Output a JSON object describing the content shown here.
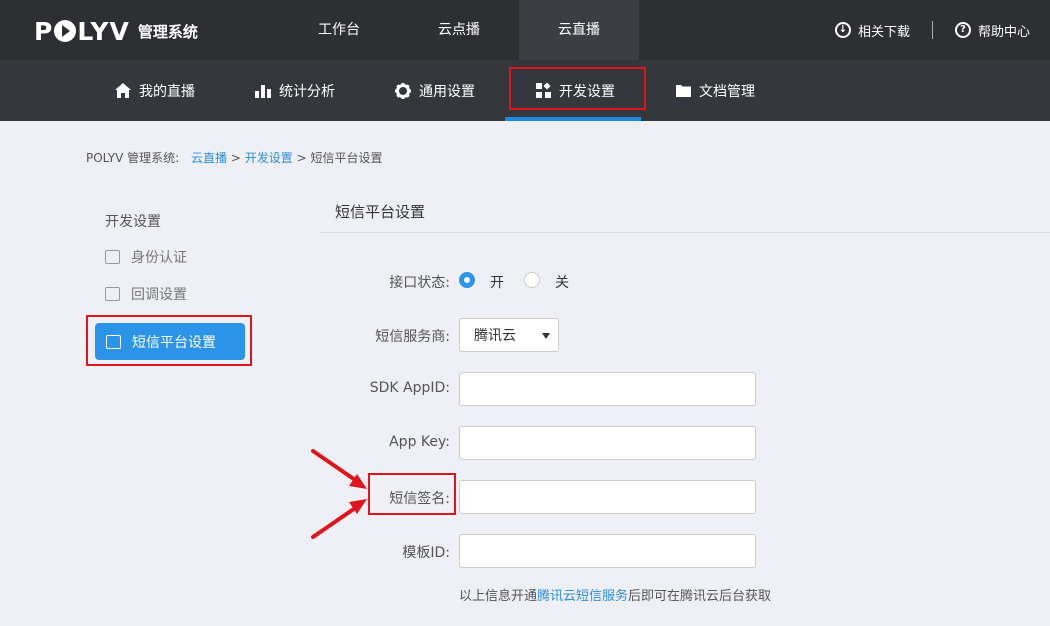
{
  "header": {
    "logo": "POLYV",
    "logo_sub": "管理系统",
    "nav": [
      "工作台",
      "云点播",
      "云直播"
    ],
    "active_nav": "云直播",
    "right": {
      "download": "相关下载",
      "help": "帮助中心"
    }
  },
  "subnav": {
    "items": [
      "我的直播",
      "统计分析",
      "通用设置",
      "开发设置",
      "文档管理"
    ],
    "active": "开发设置"
  },
  "breadcrumb": {
    "prefix": "POLYV 管理系统:",
    "link1": "云直播",
    "sep1": ">",
    "link2": "开发设置",
    "sep2": ">",
    "current": "短信平台设置"
  },
  "sidebar": {
    "title": "开发设置",
    "items": [
      "身份认证",
      "回调设置"
    ],
    "active": "短信平台设置"
  },
  "form": {
    "title": "短信平台设置",
    "status_label": "接口状态:",
    "status_on": "开",
    "status_off": "关",
    "status_value": "开",
    "provider_label": "短信服务商:",
    "provider_value": "腾讯云",
    "sdk_label": "SDK AppID:",
    "sdk_value": "",
    "appkey_label": "App Key:",
    "appkey_value": "",
    "sign_label": "短信签名:",
    "sign_value": "",
    "template_label": "模板ID:",
    "template_value": "",
    "note_before": "以上信息开通",
    "note_link": "腾讯云短信服务",
    "note_after": "后即可在腾讯云后台获取"
  },
  "colors": {
    "accent": "#2b94e8",
    "highlight": "#e1141b",
    "topbar": "#2d2f33"
  }
}
